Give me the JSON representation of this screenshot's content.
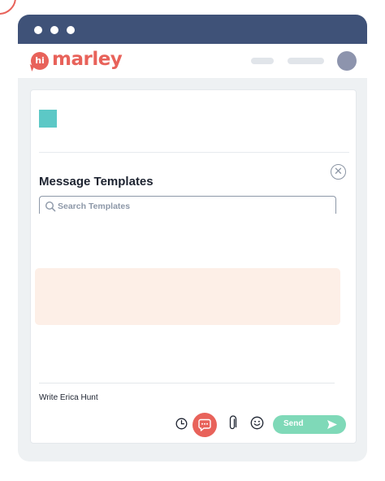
{
  "app": {
    "logo_badge": "hi",
    "logo_text": "marley"
  },
  "templates_panel": {
    "title": "Message Templates",
    "search_placeholder": "Search Templates"
  },
  "composer": {
    "placeholder": "Write Erica Hunt",
    "send_label": "Send"
  },
  "toolbar_icons": [
    "clock-icon",
    "chat-bubble-icon",
    "paperclip-icon",
    "smiley-icon",
    "send-arrow-icon"
  ],
  "colors": {
    "brand": "#e8625a",
    "titlebar": "#3f5278",
    "accent_teal": "#5cc8c6",
    "send_button": "#7fd9b8",
    "highlight": "#fdefe7"
  }
}
